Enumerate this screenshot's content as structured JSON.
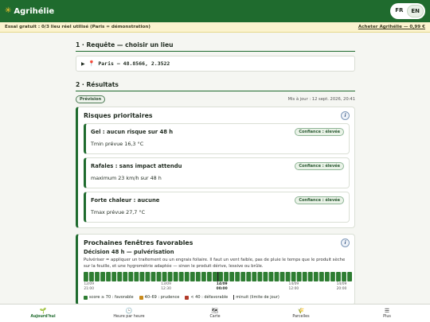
{
  "app": {
    "name": "Agrihélie",
    "icon": "sun-icon"
  },
  "language": {
    "options": [
      "FR",
      "EN"
    ],
    "selected": "EN"
  },
  "trial": {
    "text": "Essai gratuit : 0/3 lieu réel utilisé (Paris = démonstration)",
    "buy_label": "Acheter Agrihélie — 0,99 €"
  },
  "section1": {
    "title": "1 · Requête — choisir un lieu",
    "query_text": "Paris — 48.8566, 2.3522"
  },
  "section2": {
    "title": "2 · Résultats",
    "badge": "Prévision",
    "updated": "Mis à jour : 12 sept. 2026, 20:41"
  },
  "risks": {
    "title": "Risques prioritaires",
    "items": [
      {
        "title": "Gel : aucun risque sur 48 h",
        "confidence": "Confiance : élevée",
        "detail": "Tmin prévue 16,3 °C"
      },
      {
        "title": "Rafales : sans impact attendu",
        "confidence": "Confiance : élevée",
        "detail": "maximum 23 km/h sur 48 h"
      },
      {
        "title": "Forte chaleur : aucune",
        "confidence": "Confiance : élevée",
        "detail": "Tmax prévue 27,7 °C"
      }
    ]
  },
  "windows": {
    "title": "Prochaines fenêtres favorables",
    "subtitle": "Décision 48 h — pulvérisation",
    "description": "Pulvériser = appliquer un traitement ou un engrais foliaire. Il faut un vent faible, pas de pluie le temps que le produit sèche sur la feuille, et une hygrométrie adaptée — sinon le produit dérive, lessive ou brûle.",
    "ticks": [
      {
        "date": "12/09",
        "time": "21:00",
        "bold": false
      },
      {
        "date": "13/09",
        "time": "12:30",
        "bold": false
      },
      {
        "date": "14/09",
        "time": "00:00",
        "bold": true
      },
      {
        "date": "14/09",
        "time": "12:00",
        "bold": false
      },
      {
        "date": "14/09",
        "time": "20:00",
        "bold": false
      }
    ],
    "legend": [
      {
        "label": "score ≥ 70 : favorable",
        "color": "#2e7d32"
      },
      {
        "label": "40–69 : prudence",
        "color": "#c98a1b"
      },
      {
        "label": "< 40 : défavorable",
        "color": "#b23b2a"
      },
      {
        "label": "minuit (limite de jour)",
        "color": "#333333"
      }
    ],
    "colors": {
      "favorable": "#2e7d32",
      "midnight": "#1a1a1a"
    }
  },
  "nav": [
    {
      "label": "Aujourd'hui",
      "icon": "field-icon",
      "active": true
    },
    {
      "label": "Heure par heure",
      "icon": "clock-icon",
      "active": false
    },
    {
      "label": "Carte",
      "icon": "map-icon",
      "active": false
    },
    {
      "label": "Parcelles",
      "icon": "wheat-icon",
      "active": false
    },
    {
      "label": "Plus",
      "icon": "menu-icon",
      "active": false
    }
  ]
}
